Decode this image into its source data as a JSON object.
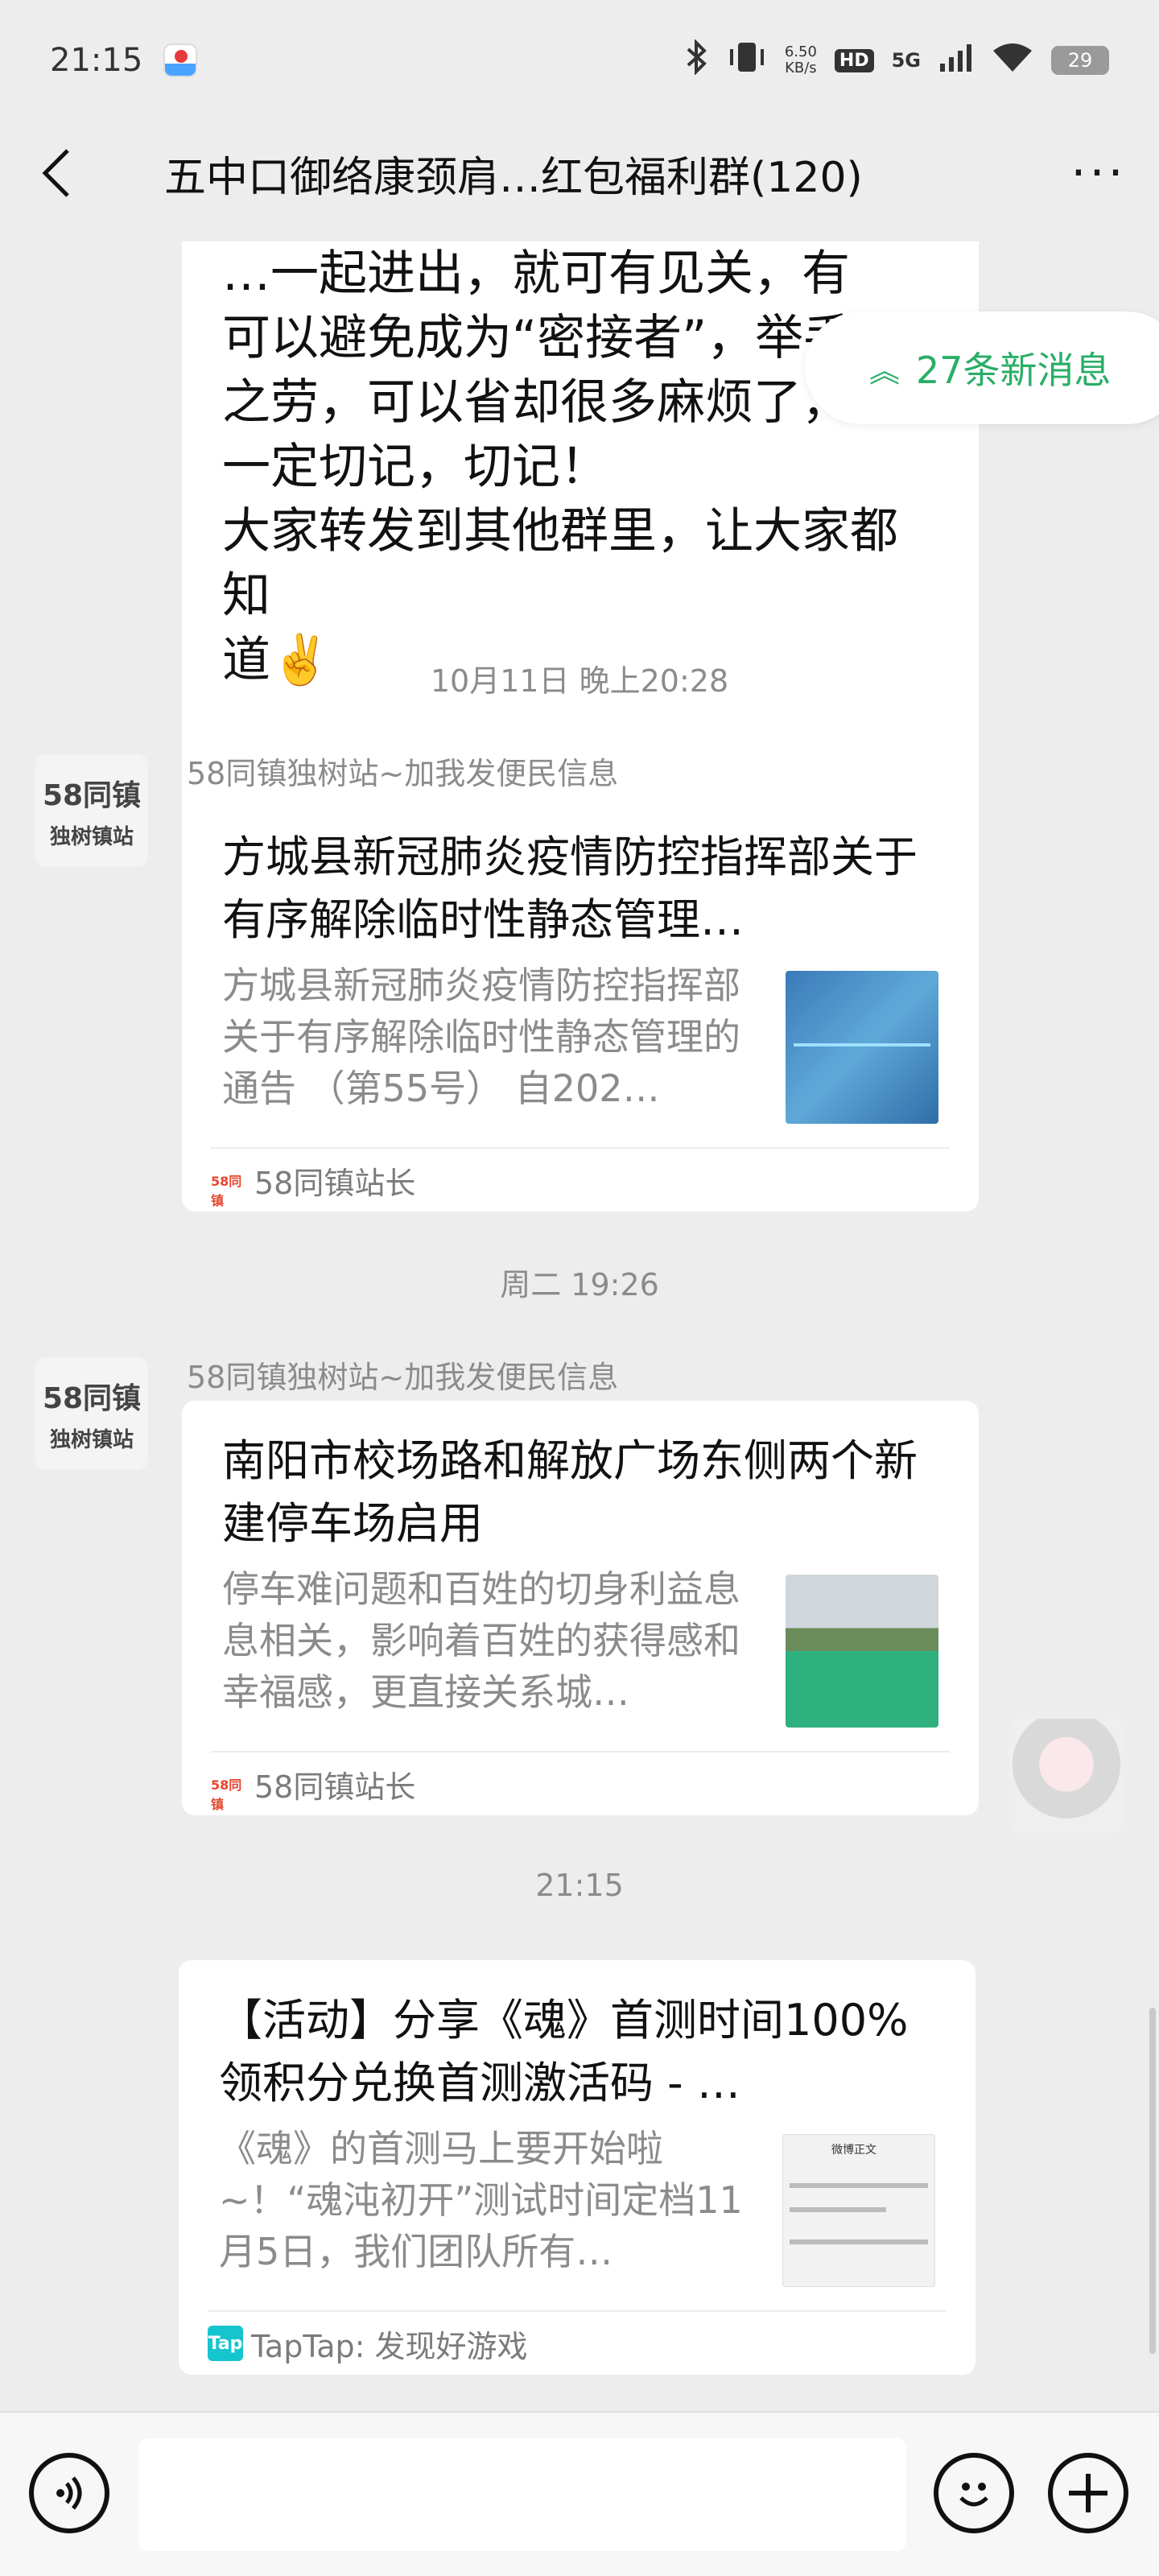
{
  "status_bar": {
    "time": "21:15",
    "net_speed": "6.50",
    "net_unit": "KB/s",
    "hd": "HD",
    "network": "5G",
    "battery": "29"
  },
  "nav": {
    "title": "五中口御络康颈肩…红包福利群(120)",
    "more": "···"
  },
  "new_messages": {
    "label": "27条新消息"
  },
  "text_message": {
    "lines": [
      "…一起进出，就可有见关，有",
      "可以避免成为“密接者”，举手",
      "之劳，可以省却很多麻烦了，",
      "一定切记，切记！",
      "大家转发到其他群里，让大家都知",
      "道✌️"
    ]
  },
  "messages": [
    {
      "timestamp": "10月11日 晚上20:28",
      "sender": "58同镇独树站~加我发便民信息",
      "avatar_text": "58同镇",
      "avatar_sub": "独树镇站",
      "title": " 方城县新冠肺炎疫情防控指挥部关于有序解除临时性静态管理…",
      "desc": "方城县新冠肺炎疫情防控指挥部 关于有序解除临时性静态管理的通告 （第55号） 自202…",
      "source": "58同镇站长"
    },
    {
      "timestamp": "周二 19:26",
      "sender": "58同镇独树站~加我发便民信息",
      "avatar_text": "58同镇",
      "avatar_sub": "独树镇站",
      "title": "南阳市校场路和解放广场东侧两个新建停车场启用",
      "desc": "停车难问题和百姓的切身利益息息相关，影响着百姓的获得感和幸福感，更直接关系城…",
      "source": "58同镇站长"
    },
    {
      "timestamp": "21:15",
      "title": "【活动】分享《魂》首测时间100%领积分兑换首测激活码 - …",
      "desc": "《魂》的首测马上要开始啦~！“魂沌初开”测试时间定档11月5日，我们团队所有…",
      "source": "TapTap: 发现好游戏",
      "thumb_label": "微博正文"
    }
  ],
  "input_bar": {
    "voice_icon": "voice-icon",
    "emoji_icon": "emoji-icon",
    "plus_icon": "plus-icon"
  },
  "colors": {
    "background": "#ededed",
    "accent": "#2aae67",
    "bubble": "#ffffff"
  }
}
